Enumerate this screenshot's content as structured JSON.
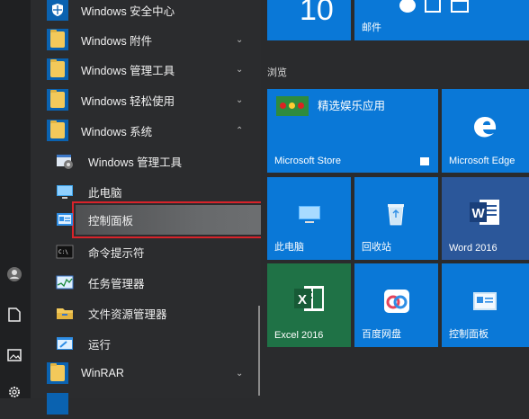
{
  "rail": {
    "icons": [
      "user-icon",
      "document-icon",
      "pictures-icon",
      "settings-icon"
    ]
  },
  "applist": {
    "items": [
      {
        "label": "Windows 安全中心",
        "type": "app",
        "icon": "shield-icon",
        "expandable": false
      },
      {
        "label": "Windows 附件",
        "type": "folder",
        "icon": "folder-icon",
        "expandable": true,
        "expanded": false
      },
      {
        "label": "Windows 管理工具",
        "type": "folder",
        "icon": "folder-icon",
        "expandable": true,
        "expanded": false
      },
      {
        "label": "Windows 轻松使用",
        "type": "folder",
        "icon": "folder-icon",
        "expandable": true,
        "expanded": false
      },
      {
        "label": "Windows 系统",
        "type": "folder",
        "icon": "folder-icon",
        "expandable": true,
        "expanded": true
      }
    ],
    "subitems": [
      {
        "label": "Windows 管理工具",
        "icon": "admin-tools-icon"
      },
      {
        "label": "此电脑",
        "icon": "this-pc-icon"
      },
      {
        "label": "控制面板",
        "icon": "control-panel-icon",
        "selected": true
      },
      {
        "label": "命令提示符",
        "icon": "cmd-icon"
      },
      {
        "label": "任务管理器",
        "icon": "task-manager-icon"
      },
      {
        "label": "文件资源管理器",
        "icon": "file-explorer-icon"
      },
      {
        "label": "运行",
        "icon": "run-icon"
      }
    ],
    "after": [
      {
        "label": "WinRAR",
        "type": "folder",
        "icon": "folder-icon",
        "expandable": true,
        "expanded": false
      }
    ]
  },
  "tiles": {
    "calendar_number": "10",
    "mail_label": "邮件",
    "section_label": "浏览",
    "store_label": "Microsoft Store",
    "store_headline": "精选娱乐应用",
    "edge_label": "Microsoft Edge",
    "pc_label": "此电脑",
    "recycle_label": "回收站",
    "word_label": "Word 2016",
    "excel_label": "Excel 2016",
    "baidu_label": "百度网盘",
    "cp_label": "控制面板"
  },
  "colors": {
    "tile_blue": "#0a78d7",
    "excel_green": "#1f7246",
    "word_blue": "#2b579a",
    "selection_border": "#d8232a"
  }
}
